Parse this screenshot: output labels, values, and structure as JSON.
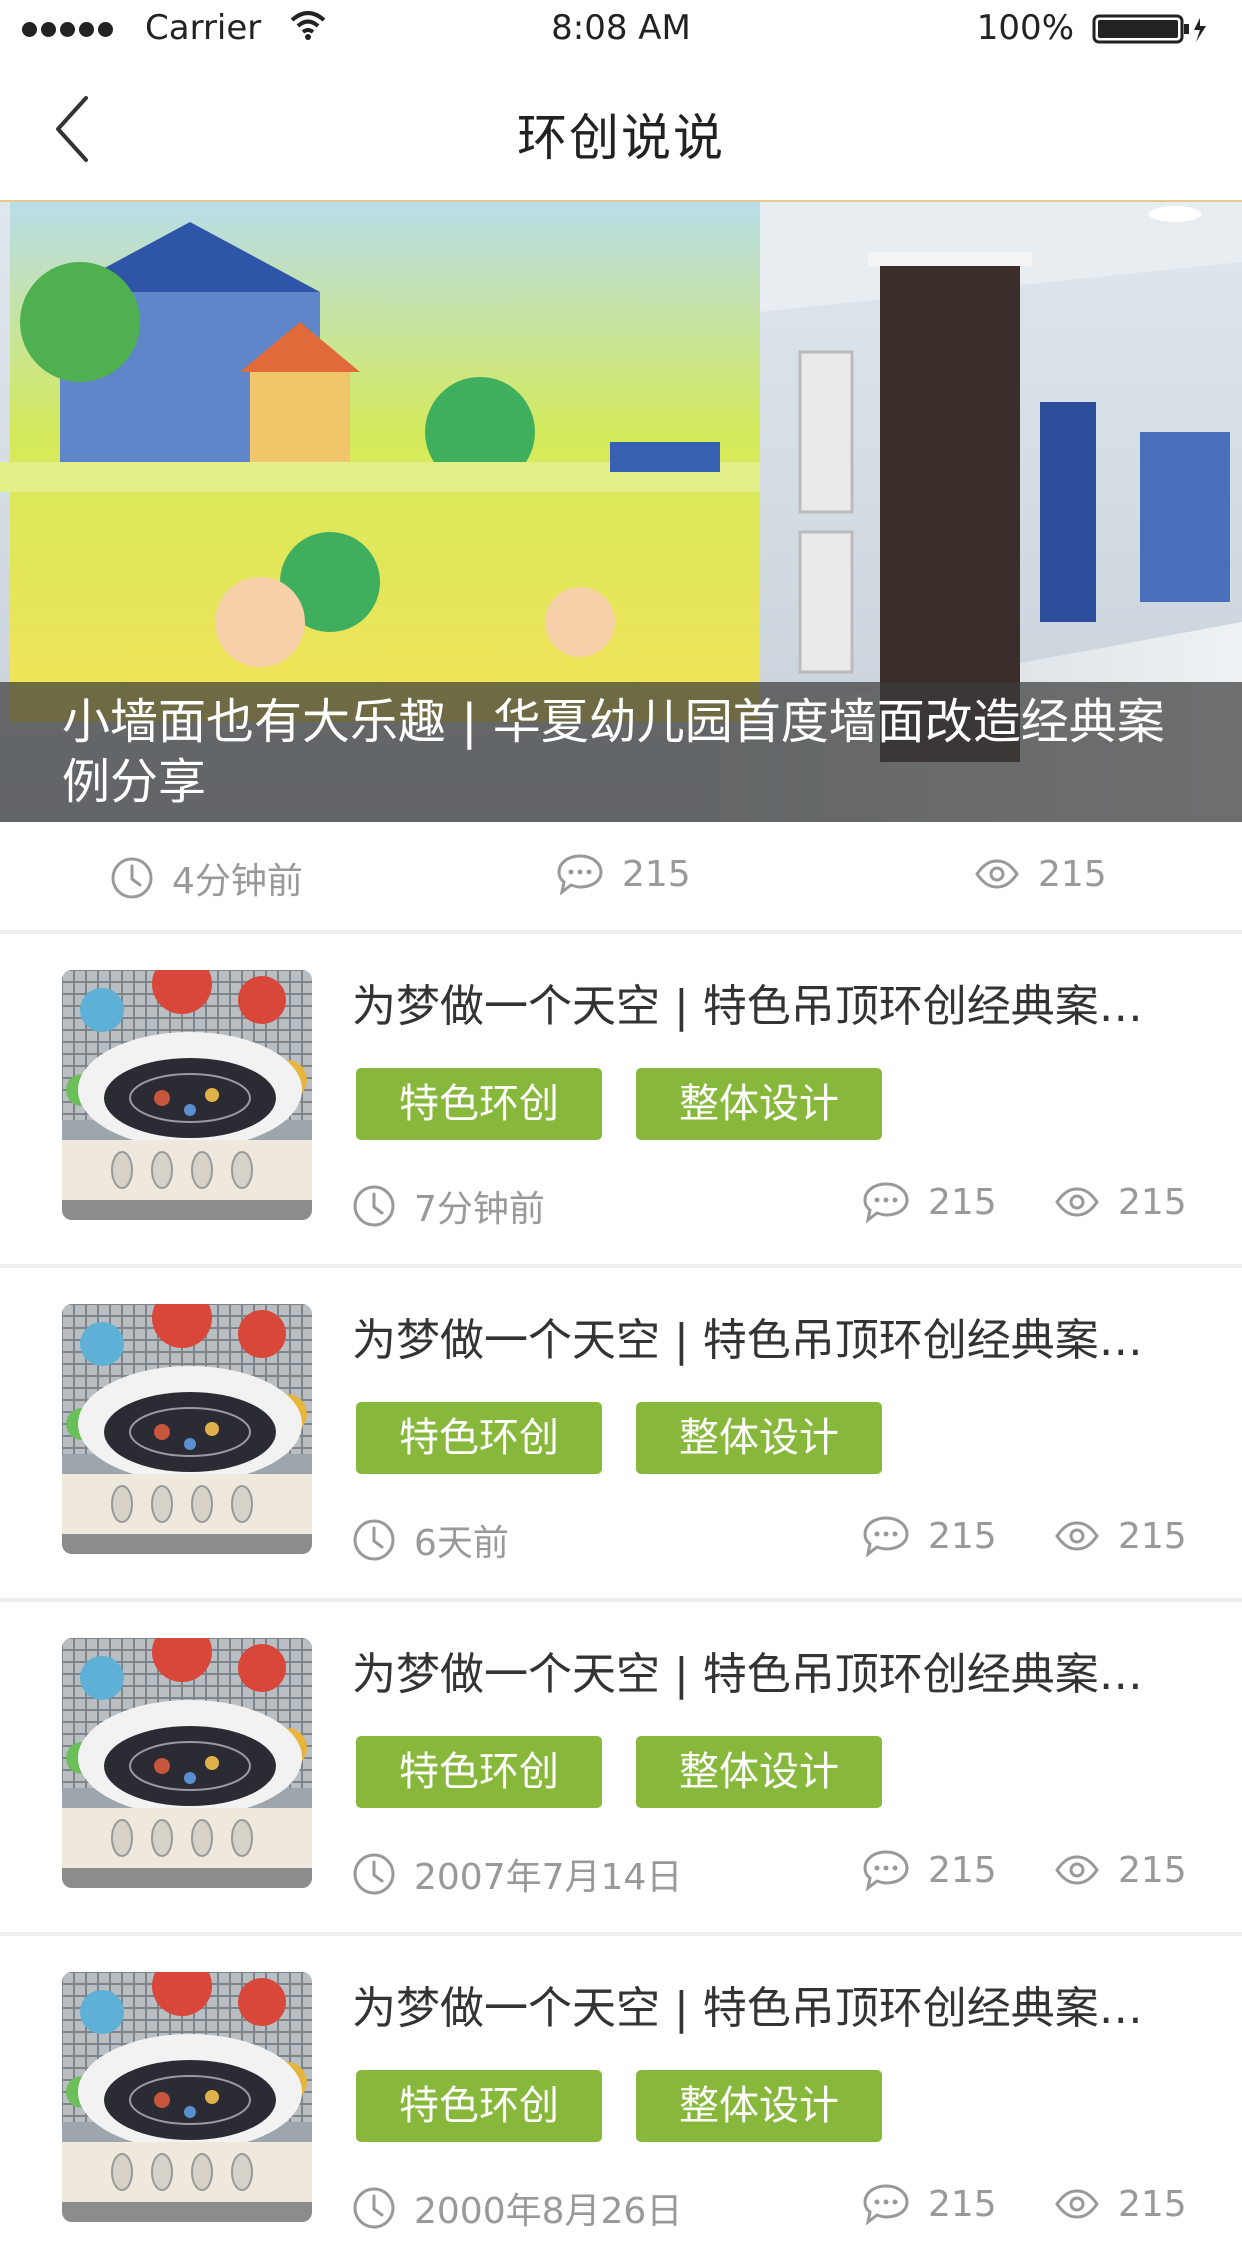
{
  "status_bar": {
    "carrier": "Carrier",
    "time": "8:08 AM",
    "battery": "100%"
  },
  "nav": {
    "title": "环创说说"
  },
  "hero": {
    "caption": "小墙面也有大乐趣 | 华夏幼儿园首度墙面改造经典案例分享",
    "time": "4分钟前",
    "comments": "215",
    "views": "215"
  },
  "items": [
    {
      "title": "为梦做一个天空 | 特色吊顶环创经典案例分享",
      "tags": [
        "特色环创",
        "整体设计"
      ],
      "time": "7分钟前",
      "comments": "215",
      "views": "215"
    },
    {
      "title": "为梦做一个天空 | 特色吊顶环创经典案例分享",
      "tags": [
        "特色环创",
        "整体设计"
      ],
      "time": "6天前",
      "comments": "215",
      "views": "215"
    },
    {
      "title": "为梦做一个天空 | 特色吊顶环创经典案例分享",
      "tags": [
        "特色环创",
        "整体设计"
      ],
      "time": "2007年7月14日",
      "comments": "215",
      "views": "215"
    },
    {
      "title": "为梦做一个天空 | 特色吊顶环创经典案例分享",
      "tags": [
        "特色环创",
        "整体设计"
      ],
      "time": "2000年8月26日",
      "comments": "215",
      "views": "215"
    }
  ],
  "colors": {
    "tag_green": "#87b83b",
    "nav_border": "#e9c98a"
  }
}
